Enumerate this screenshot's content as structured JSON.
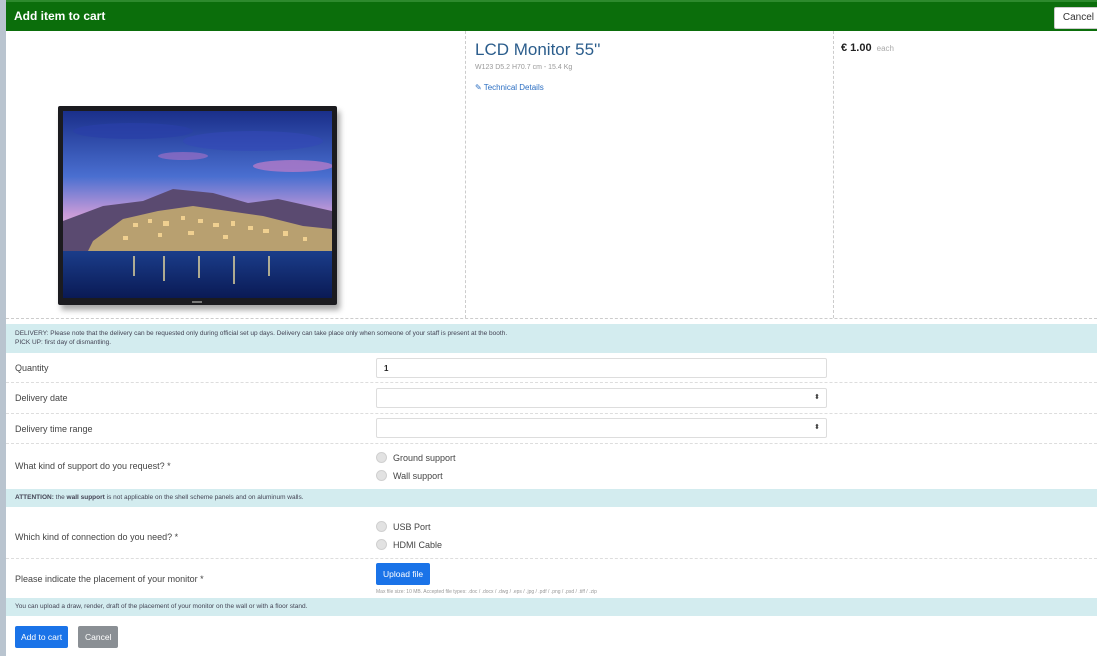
{
  "header": {
    "title": "Add item to cart",
    "cancel_label": "Cancel"
  },
  "product": {
    "name": "LCD Monitor 55''",
    "dimensions": "W123 D5.2 H70.7 cm - 15.4 Kg",
    "tech_link": "Technical Details",
    "price": "€ 1.00",
    "price_unit": "each",
    "image_icon": "lcd-monitor-photo"
  },
  "notices": {
    "delivery_line1": "DELIVERY: Please note that the delivery can be requested only during official set up days. Delivery can take place only when someone of your staff is present at the booth.",
    "delivery_line2": "PICK UP: first day of dismantling.",
    "attention_prefix": "ATTENTION:",
    "attention_mid1": " the ",
    "attention_bold": "wall support",
    "attention_rest": " is not applicable on the shell scheme panels and on aluminum walls.",
    "upload_note": "You can upload a draw, render, draft of the placement of your monitor on the wall or with a floor stand."
  },
  "form": {
    "quantity_label": "Quantity",
    "quantity_value": "1",
    "delivery_date_label": "Delivery date",
    "delivery_date_value": "",
    "delivery_time_label": "Delivery time range",
    "delivery_time_value": "",
    "support_label": "What kind of support do you request? *",
    "support_options": [
      "Ground support",
      "Wall support"
    ],
    "connection_label": "Which kind of connection do you need? *",
    "connection_options": [
      "USB Port",
      "HDMI Cable"
    ],
    "placement_label": "Please indicate the placement of your monitor *",
    "upload_label": "Upload file",
    "upload_hint": "Max file size: 10 MB. Accepted file types: .doc / .docx / .dwg / .eps / .jpg / .pdf / .png / .psd / .tiff / .zip"
  },
  "footer": {
    "add_label": "Add to cart",
    "cancel_label": "Cancel"
  },
  "colors": {
    "header_bg": "#0b6e0b",
    "primary": "#1a73e8",
    "info_bg": "#d3ecef",
    "secondary": "#8a8f94"
  }
}
